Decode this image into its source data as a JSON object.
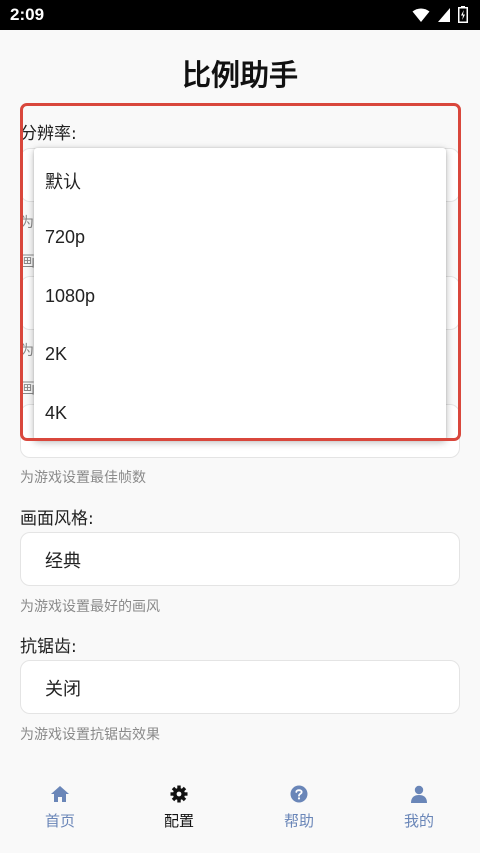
{
  "status_bar": {
    "time": "2:09"
  },
  "page": {
    "title": "比例助手"
  },
  "fields": {
    "resolution": {
      "label": "分辨率:",
      "options": [
        "默认",
        "720p",
        "1080p",
        "2K",
        "4K"
      ]
    },
    "hidden_hint_1": "为",
    "hidden_label_1": "画",
    "hidden_hint_2": "为",
    "hidden_label_2": "画",
    "framerate": {
      "hint": "为游戏设置最佳帧数"
    },
    "style": {
      "label": "画面风格:",
      "value": "经典",
      "hint": "为游戏设置最好的画风"
    },
    "antialias": {
      "label": "抗锯齿:",
      "value": "关闭",
      "hint": "为游戏设置抗锯齿效果"
    }
  },
  "nav": {
    "items": [
      {
        "label": "首页",
        "icon": "home-icon"
      },
      {
        "label": "配置",
        "icon": "gear-icon"
      },
      {
        "label": "帮助",
        "icon": "help-icon"
      },
      {
        "label": "我的",
        "icon": "user-icon"
      }
    ],
    "active_index": 1
  },
  "colors": {
    "highlight": "#d9473c",
    "nav_inactive": "#6a86b8",
    "nav_active": "#111111"
  }
}
